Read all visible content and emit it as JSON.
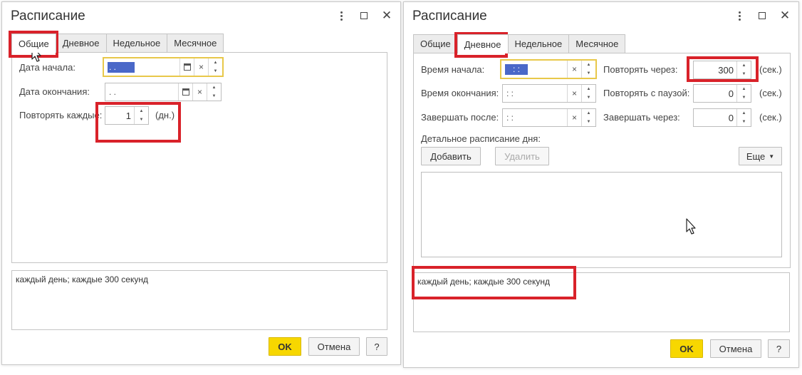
{
  "left_dialog": {
    "title": "Расписание",
    "tabs": [
      "Общие",
      "Дневное",
      "Недельное",
      "Месячное"
    ],
    "active_tab": "Общие",
    "start_date_label": "Дата начала:",
    "start_date_value": ". .",
    "end_date_label": "Дата окончания:",
    "end_date_value": ". .",
    "repeat_every_label": "Повторять каждые:",
    "repeat_every_value": "1",
    "repeat_every_unit": "(дн.)",
    "summary": "каждый день; каждые 300 секунд",
    "ok_label": "OK",
    "cancel_label": "Отмена",
    "help_label": "?"
  },
  "right_dialog": {
    "title": "Расписание",
    "tabs": [
      "Общие",
      "Дневное",
      "Недельное",
      "Месячное"
    ],
    "active_tab": "Дневное",
    "start_time_label": "Время начала:",
    "start_time_value": ": :",
    "end_time_label": "Время окончания:",
    "end_time_value": ": :",
    "finish_after_label": "Завершать после:",
    "finish_after_value": ": :",
    "repeat_after_label": "Повторять через:",
    "repeat_after_value": "300",
    "repeat_pause_label": "Повторять с паузой:",
    "repeat_pause_value": "0",
    "finish_in_label": "Завершать через:",
    "finish_in_value": "0",
    "unit_sec": "(сек.)",
    "detail_label": "Детальное расписание дня:",
    "add_label": "Добавить",
    "delete_label": "Удалить",
    "more_label": "Еще",
    "summary": "каждый день; каждые 300 секунд",
    "ok_label": "OK",
    "cancel_label": "Отмена",
    "help_label": "?"
  },
  "colors": {
    "highlight_red": "#d9222a",
    "ok_yellow": "#f7d700",
    "focus_yellow": "#e8c84a",
    "selection_blue": "#4a68c8"
  }
}
